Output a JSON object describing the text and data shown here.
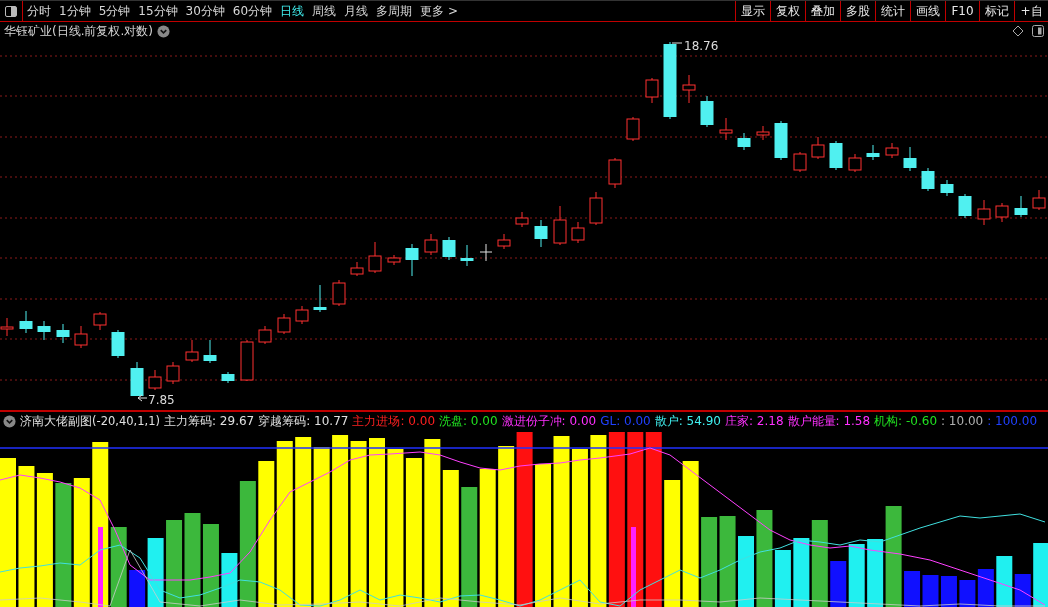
{
  "toolbar": {
    "periods": [
      {
        "label": "分时",
        "selected": false
      },
      {
        "label": "1分钟",
        "selected": false
      },
      {
        "label": "5分钟",
        "selected": false
      },
      {
        "label": "15分钟",
        "selected": false
      },
      {
        "label": "30分钟",
        "selected": false
      },
      {
        "label": "60分钟",
        "selected": false
      },
      {
        "label": "日线",
        "selected": true
      },
      {
        "label": "周线",
        "selected": false
      },
      {
        "label": "月线",
        "selected": false
      },
      {
        "label": "多周期",
        "selected": false
      },
      {
        "label": "更多 >",
        "selected": false
      }
    ],
    "buttons": [
      "显示",
      "复权",
      "叠加",
      "多股",
      "统计",
      "画线",
      "F10",
      "标记",
      "+自"
    ]
  },
  "main_chart": {
    "title": "华钰矿业(日线.前复权.对数)",
    "high_label": "18.76",
    "low_label": "7.85"
  },
  "indicator": {
    "name": "济南大佬副图(-20,40,1,1)",
    "metrics": [
      {
        "text": "主力筹码: 29.67",
        "color": "#e0e0e0"
      },
      {
        "text": "穿越筹码: 10.77",
        "color": "#e0e0e0"
      },
      {
        "text": "主力进场: 0.00",
        "color": "#ff2020"
      },
      {
        "text": "洗盘: 0.00",
        "color": "#20e020"
      },
      {
        "text": "激进份子冲: 0.00",
        "color": "#ff30ff"
      },
      {
        "text": "GL: 0.00",
        "color": "#2040ff"
      },
      {
        "text": "散户: 54.90",
        "color": "#40f0f0"
      },
      {
        "text": "庄家: 2.18",
        "color": "#ff30ff"
      },
      {
        "text": "散户能量: 1.58",
        "color": "#ff30ff"
      },
      {
        "text": "机构: -0.60",
        "color": "#20e020"
      },
      {
        "text": ": 10.00",
        "color": "#b0b0b0"
      },
      {
        "text": ": 100.00",
        "color": "#2040ff"
      }
    ]
  }
}
